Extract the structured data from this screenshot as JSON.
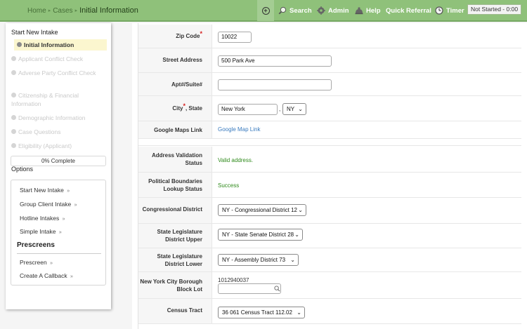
{
  "breadcrumb": {
    "home": "Home",
    "cases": "Cases",
    "current": "Initial Information"
  },
  "nav": {
    "search": "Search",
    "admin": "Admin",
    "help": "Help",
    "quick_referral": "Quick Referral",
    "timer": "Timer",
    "status": "Not Started - 0:00"
  },
  "sidebar": {
    "title": "Start New Intake",
    "steps": [
      "Initial Information",
      "Applicant Conflict Check",
      "Adverse Party Conflict Check",
      "Citizenship & Financial Information",
      "Demographic Information",
      "Case Questions",
      "Eligibility (Applicant)"
    ],
    "progress_label": "0% Complete",
    "progress_fraction": 0,
    "options_title": "Options",
    "options": [
      "Start New Intake",
      "Group Client Intake",
      "Hotline Intakes",
      "Simple Intake"
    ],
    "prescreens_title": "Prescreens",
    "prescreens": [
      "Prescreen",
      "Create A Callback"
    ],
    "arrow": "»"
  },
  "form": {
    "zip_label": "Zip Code",
    "zip_value": "10022",
    "street_label": "Street Address",
    "street_value": "500 Park Ave",
    "apt_label": "Apt#/Suite#",
    "apt_value": "",
    "city_label": "City",
    "state_label": ", State",
    "city_value": "New York",
    "state_sep": ",",
    "state_value": "NY",
    "maps_label": "Google Maps Link",
    "maps_link": "Google Map Link",
    "addr_val_label": "Address Validation Status",
    "addr_val_value": "Valid address.",
    "pol_label": "Political Boundaries Lookup Status",
    "pol_value": "Success",
    "cong_label": "Congressional District",
    "cong_value": "NY - Congressional District 12",
    "upper_label": "State Legislature District Upper",
    "upper_value": "NY - State Senate District 28",
    "lower_label": "State Legislature District Lower",
    "lower_value": "NY - Assembly District 73",
    "bbl_label": "New York City Borough Block Lot",
    "bbl_value": "1012940037",
    "bbl_input": "",
    "tract_label": "Census Tract",
    "tract_value": "36 061 Census Tract 112.02",
    "required_mark": "*"
  },
  "colors": {
    "topbar": "#8fc17a",
    "link": "#3a7bbf",
    "success": "#2f8a1b",
    "required": "#d62020"
  }
}
